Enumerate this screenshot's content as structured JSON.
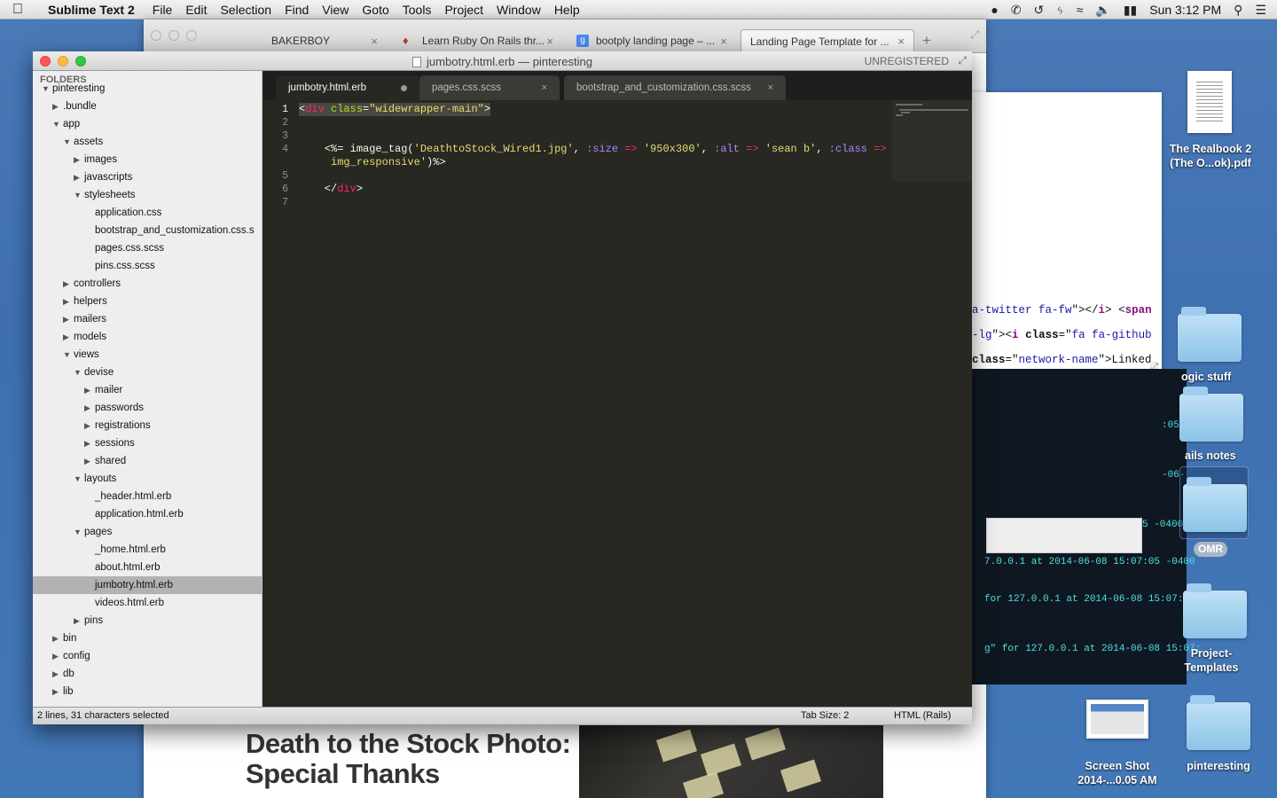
{
  "menubar": {
    "app_name": "Sublime Text 2",
    "items": [
      "File",
      "Edit",
      "Selection",
      "Find",
      "View",
      "Goto",
      "Tools",
      "Project",
      "Window",
      "Help"
    ],
    "clock": "Sun 3:12 PM"
  },
  "browser": {
    "tabs": [
      {
        "label": "BAKERBOY"
      },
      {
        "label": "Learn Ruby On Rails thr..."
      },
      {
        "label": "bootply landing page – ..."
      },
      {
        "label": "Landing Page Template for ..."
      }
    ],
    "headline_line1": "Death to the Stock Photo:",
    "headline_line2": "Special Thanks"
  },
  "web_panel": {
    "code_lines": [
      "a-twitter fa-fw\"></i> <span",
      "-lg\"><i class=\"fa fa-github",
      " class=\"network-name\">Linked"
    ]
  },
  "terminal": {
    "lines": [
      ":05",
      "-06-",
      "5 -0400",
      "7.0.0.1 at 2014-06-08 15:07:05 -0400",
      " for 127.0.0.1 at 2014-06-08 15:07:05",
      "g\" for 127.0.0.1 at 2014-06-08 15:07:"
    ]
  },
  "sublime": {
    "window_title": "jumbotry.html.erb — pinteresting",
    "unregistered": "UNREGISTERED",
    "sidebar_title": "FOLDERS",
    "tree": [
      {
        "label": "pinteresting",
        "depth": 0,
        "arrow": "open"
      },
      {
        "label": ".bundle",
        "depth": 1,
        "arrow": "closed"
      },
      {
        "label": "app",
        "depth": 1,
        "arrow": "open"
      },
      {
        "label": "assets",
        "depth": 2,
        "arrow": "open"
      },
      {
        "label": "images",
        "depth": 3,
        "arrow": "closed"
      },
      {
        "label": "javascripts",
        "depth": 3,
        "arrow": "closed"
      },
      {
        "label": "stylesheets",
        "depth": 3,
        "arrow": "open"
      },
      {
        "label": "application.css",
        "depth": 4,
        "arrow": "none"
      },
      {
        "label": "bootstrap_and_customization.css.s",
        "depth": 4,
        "arrow": "none"
      },
      {
        "label": "pages.css.scss",
        "depth": 4,
        "arrow": "none"
      },
      {
        "label": "pins.css.scss",
        "depth": 4,
        "arrow": "none"
      },
      {
        "label": "controllers",
        "depth": 2,
        "arrow": "closed"
      },
      {
        "label": "helpers",
        "depth": 2,
        "arrow": "closed"
      },
      {
        "label": "mailers",
        "depth": 2,
        "arrow": "closed"
      },
      {
        "label": "models",
        "depth": 2,
        "arrow": "closed"
      },
      {
        "label": "views",
        "depth": 2,
        "arrow": "open"
      },
      {
        "label": "devise",
        "depth": 3,
        "arrow": "open"
      },
      {
        "label": "mailer",
        "depth": 4,
        "arrow": "closed"
      },
      {
        "label": "passwords",
        "depth": 4,
        "arrow": "closed"
      },
      {
        "label": "registrations",
        "depth": 4,
        "arrow": "closed"
      },
      {
        "label": "sessions",
        "depth": 4,
        "arrow": "closed"
      },
      {
        "label": "shared",
        "depth": 4,
        "arrow": "closed"
      },
      {
        "label": "layouts",
        "depth": 3,
        "arrow": "open"
      },
      {
        "label": "_header.html.erb",
        "depth": 4,
        "arrow": "none"
      },
      {
        "label": "application.html.erb",
        "depth": 4,
        "arrow": "none"
      },
      {
        "label": "pages",
        "depth": 3,
        "arrow": "open"
      },
      {
        "label": "_home.html.erb",
        "depth": 4,
        "arrow": "none"
      },
      {
        "label": "about.html.erb",
        "depth": 4,
        "arrow": "none"
      },
      {
        "label": "jumbotry.html.erb",
        "depth": 4,
        "arrow": "none",
        "selected": true
      },
      {
        "label": "videos.html.erb",
        "depth": 4,
        "arrow": "none"
      },
      {
        "label": "pins",
        "depth": 3,
        "arrow": "closed"
      },
      {
        "label": "bin",
        "depth": 1,
        "arrow": "closed"
      },
      {
        "label": "config",
        "depth": 1,
        "arrow": "closed"
      },
      {
        "label": "db",
        "depth": 1,
        "arrow": "closed"
      },
      {
        "label": "lib",
        "depth": 1,
        "arrow": "closed"
      }
    ],
    "tabs": [
      {
        "label": "jumbotry.html.erb",
        "active": true,
        "dirty": true
      },
      {
        "label": "pages.css.scss",
        "active": false,
        "dirty": false
      },
      {
        "label": "bootstrap_and_customization.css.scss",
        "active": false,
        "dirty": false
      }
    ],
    "line_numbers": [
      "1",
      "2",
      "3",
      "4",
      "",
      "5",
      "6",
      "7"
    ],
    "code": {
      "l1_tag": "div",
      "l1_attr": "class",
      "l1_value": "\"widewrapper-main\"",
      "l4_open": "<%=",
      "l4_fn": " image_tag(",
      "l4_file": "'DeathtoStock_Wired1.jpg'",
      "l4_size_key": ":size",
      "l4_size_val": "'950x300'",
      "l4_alt_key": ":alt",
      "l4_alt_val": "'sean b'",
      "l4_class_key": ":class",
      "l4_class_val_a": "'",
      "l4_class_val_b": "img_responsive'",
      "l4_close": "%>",
      "l6_close_tag": "div"
    },
    "status_left": "2 lines, 31 characters selected",
    "tab_size": "Tab Size: 2",
    "syntax": "HTML (Rails)"
  },
  "desktop": {
    "icons": [
      {
        "label": "The Realbook 2 (The O...ok).pdf"
      },
      {
        "label": "ogic stuff"
      },
      {
        "label": "ails notes"
      },
      {
        "label": "OMR"
      },
      {
        "label": "Project-Templates"
      },
      {
        "label": "Screen Shot 2014-...0.05 AM"
      },
      {
        "label": "pinteresting"
      }
    ]
  }
}
